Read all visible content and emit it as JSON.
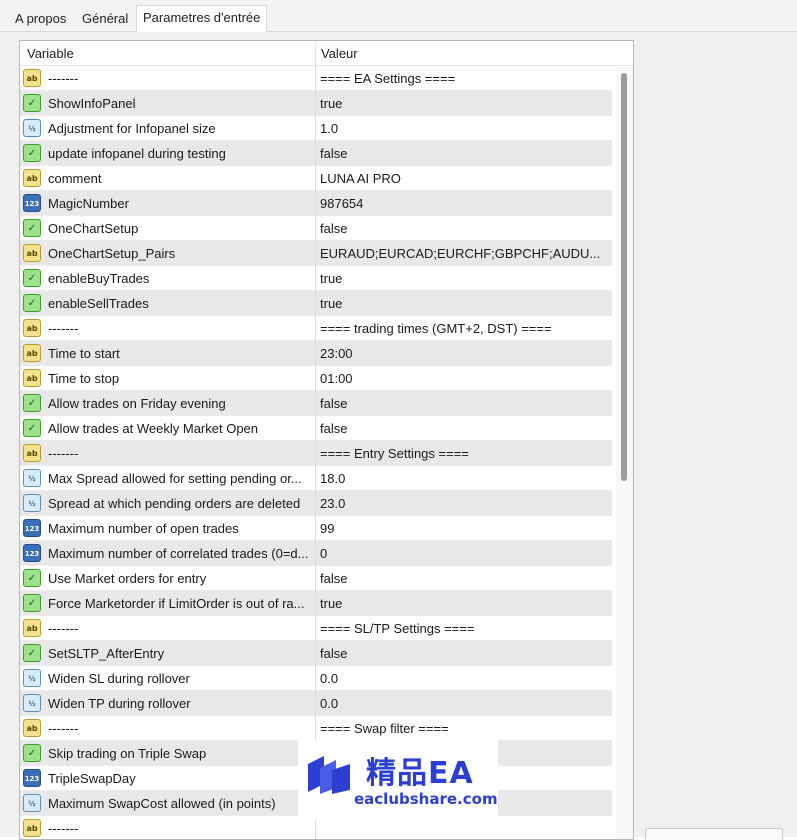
{
  "tabs": [
    {
      "label": "A propos"
    },
    {
      "label": "Général"
    },
    {
      "label": "Parametres d'entrée"
    }
  ],
  "grid": {
    "col_variable": "Variable",
    "col_value": "Valeur",
    "rows": [
      {
        "type": "ab",
        "type_glyph": "ab",
        "name": "-------",
        "value": "==== EA Settings ===="
      },
      {
        "type": "bool",
        "type_glyph": "✓",
        "name": "ShowInfoPanel",
        "value": "true"
      },
      {
        "type": "dbl",
        "type_glyph": "½",
        "name": "Adjustment for Infopanel size",
        "value": "1.0"
      },
      {
        "type": "bool",
        "type_glyph": "✓",
        "name": "update infopanel during testing",
        "value": "false"
      },
      {
        "type": "ab",
        "type_glyph": "ab",
        "name": "comment",
        "value": "LUNA AI PRO"
      },
      {
        "type": "int",
        "type_glyph": "123",
        "name": "MagicNumber",
        "value": "987654"
      },
      {
        "type": "bool",
        "type_glyph": "✓",
        "name": "OneChartSetup",
        "value": "false"
      },
      {
        "type": "ab",
        "type_glyph": "ab",
        "name": "OneChartSetup_Pairs",
        "value": "EURAUD;EURCAD;EURCHF;GBPCHF;AUDU..."
      },
      {
        "type": "bool",
        "type_glyph": "✓",
        "name": "enableBuyTrades",
        "value": "true"
      },
      {
        "type": "bool",
        "type_glyph": "✓",
        "name": "enableSellTrades",
        "value": "true"
      },
      {
        "type": "ab",
        "type_glyph": "ab",
        "name": "-------",
        "value": "==== trading times (GMT+2, DST) ===="
      },
      {
        "type": "ab",
        "type_glyph": "ab",
        "name": "Time to start",
        "value": "23:00"
      },
      {
        "type": "ab",
        "type_glyph": "ab",
        "name": "Time to stop",
        "value": "01:00"
      },
      {
        "type": "bool",
        "type_glyph": "✓",
        "name": "Allow trades on Friday evening",
        "value": "false"
      },
      {
        "type": "bool",
        "type_glyph": "✓",
        "name": "Allow trades at Weekly Market Open",
        "value": "false"
      },
      {
        "type": "ab",
        "type_glyph": "ab",
        "name": "-------",
        "value": "==== Entry Settings ===="
      },
      {
        "type": "dbl",
        "type_glyph": "½",
        "name": "Max Spread allowed for setting pending or...",
        "value": "18.0"
      },
      {
        "type": "dbl",
        "type_glyph": "½",
        "name": "Spread at which pending orders are deleted",
        "value": "23.0"
      },
      {
        "type": "int",
        "type_glyph": "123",
        "name": "Maximum number of open trades",
        "value": "99"
      },
      {
        "type": "int",
        "type_glyph": "123",
        "name": "Maximum number of correlated trades (0=d...",
        "value": "0"
      },
      {
        "type": "bool",
        "type_glyph": "✓",
        "name": "Use Market orders for entry",
        "value": "false"
      },
      {
        "type": "bool",
        "type_glyph": "✓",
        "name": "Force Marketorder if LimitOrder is out of ra...",
        "value": "true"
      },
      {
        "type": "ab",
        "type_glyph": "ab",
        "name": "-------",
        "value": "==== SL/TP Settings ===="
      },
      {
        "type": "bool",
        "type_glyph": "✓",
        "name": "SetSLTP_AfterEntry",
        "value": "false"
      },
      {
        "type": "dbl",
        "type_glyph": "½",
        "name": "Widen SL during rollover",
        "value": "0.0"
      },
      {
        "type": "dbl",
        "type_glyph": "½",
        "name": "Widen TP during rollover",
        "value": "0.0"
      },
      {
        "type": "ab",
        "type_glyph": "ab",
        "name": "-------",
        "value": "==== Swap filter ===="
      },
      {
        "type": "bool",
        "type_glyph": "✓",
        "name": "Skip trading on Triple Swap",
        "value": ""
      },
      {
        "type": "int",
        "type_glyph": "123",
        "name": "TripleSwapDay",
        "value": ""
      },
      {
        "type": "dbl",
        "type_glyph": "½",
        "name": "Maximum SwapCost allowed (in points)",
        "value": ""
      },
      {
        "type": "ab",
        "type_glyph": "ab",
        "name": "-------",
        "value": ""
      }
    ]
  },
  "watermark": {
    "title": "精品EA",
    "url": "eaclubshare.com",
    "color": "#2d3fd3"
  }
}
